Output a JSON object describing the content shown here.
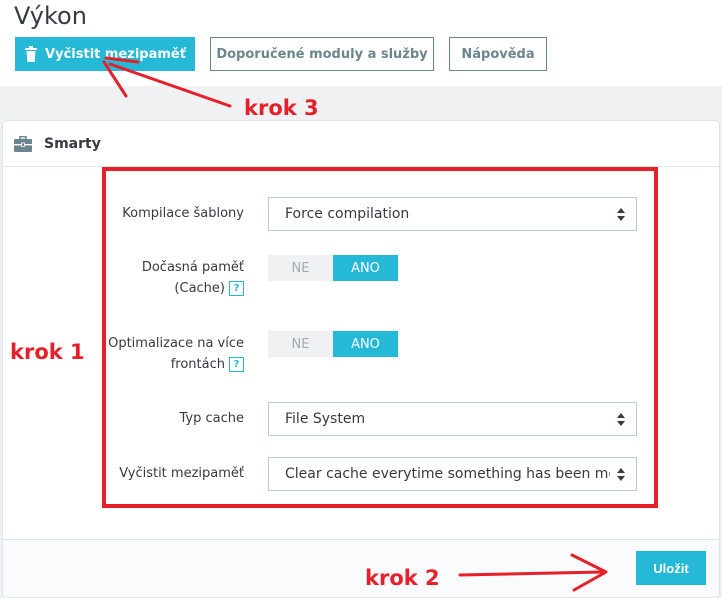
{
  "page": {
    "title": "Výkon"
  },
  "toolbar": {
    "clear_cache_label": "Vyčistit mezipaměť",
    "recommended_label": "Doporučené moduly a služby",
    "help_label": "Nápověda"
  },
  "panel": {
    "title": "Smarty",
    "fields": [
      {
        "label": "Kompilace šablony",
        "value": "Force compilation"
      },
      {
        "label_line1": "Dočasná paměť",
        "label_line2": "(Cache)",
        "off_label": "NE",
        "on_label": "ANO",
        "selected": "ANO"
      },
      {
        "label_line1": "Optimalizace na více",
        "label_line2": "frontách",
        "off_label": "NE",
        "on_label": "ANO",
        "selected": "ANO"
      },
      {
        "label": "Typ cache",
        "value": "File System"
      },
      {
        "label": "Vyčistit mezipaměť",
        "value": "Clear cache everytime something has been modified"
      }
    ],
    "help_badge": "?",
    "save_label": "Uložit"
  },
  "annotations": {
    "step1": "krok 1",
    "step2": "krok 2",
    "step3": "krok 3",
    "color": "#e6202a"
  },
  "colors": {
    "accent": "#25b9d7",
    "text": "#363a41",
    "muted": "#6c868e"
  },
  "icons": {
    "toolbar": "trash-icon",
    "panel": "briefcase-icon"
  }
}
